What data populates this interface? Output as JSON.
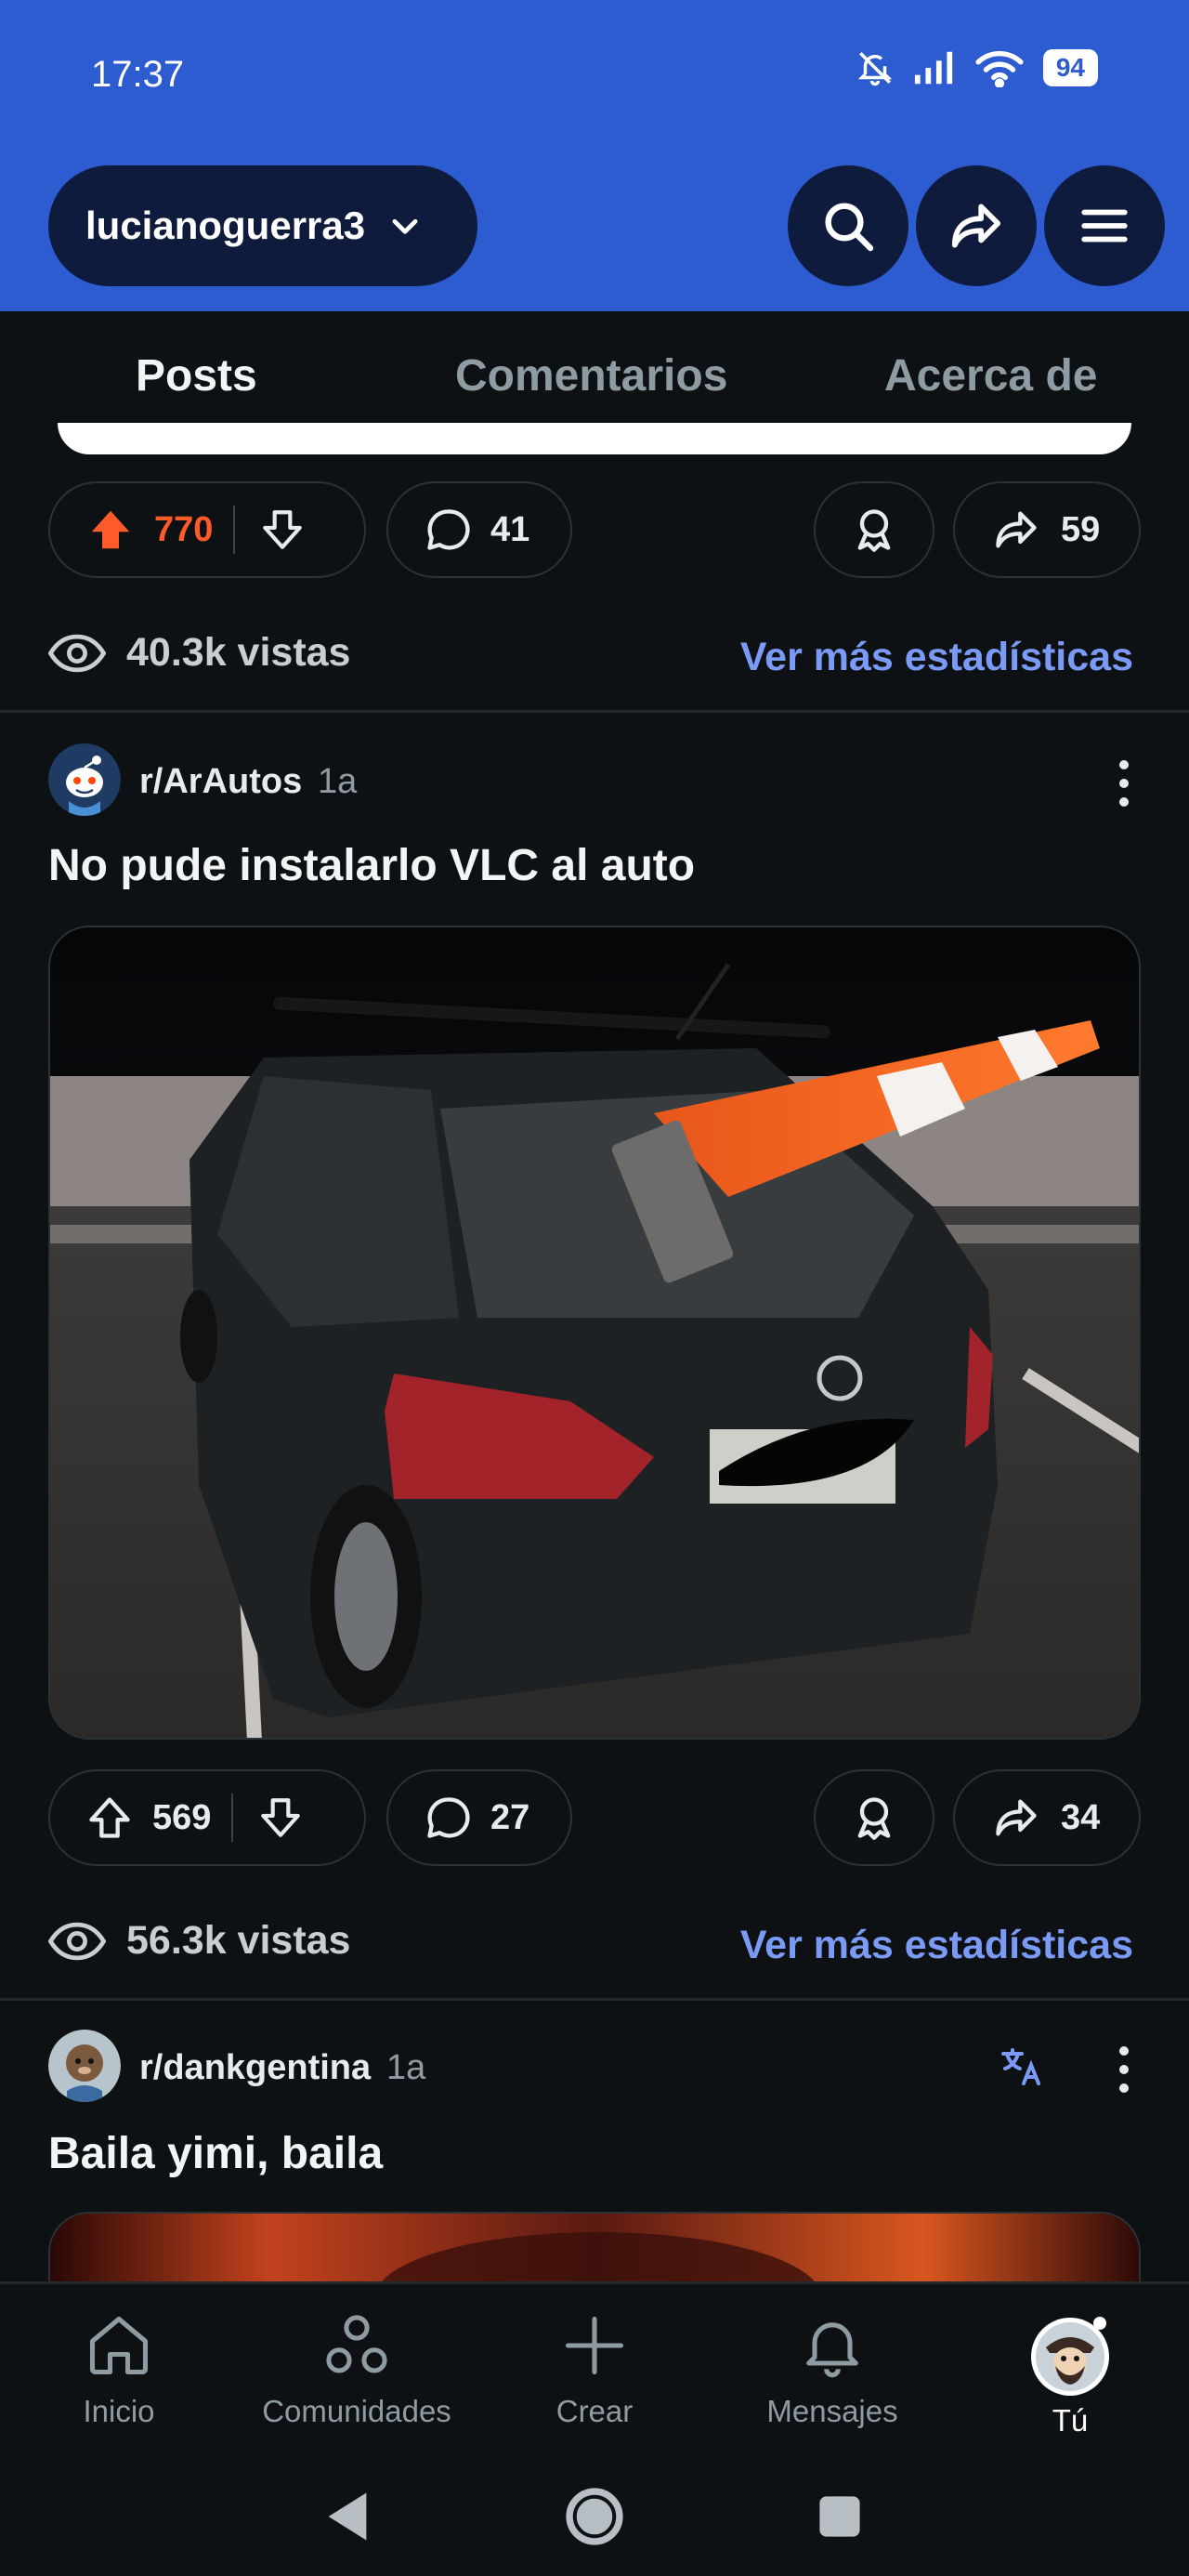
{
  "status_bar": {
    "time": "17:37",
    "battery": "94"
  },
  "header": {
    "account_name": "lucianoguerra3"
  },
  "tabs": [
    {
      "label": "Posts"
    },
    {
      "label": "Comentarios"
    },
    {
      "label": "Acerca de"
    }
  ],
  "previous_post": {
    "upvotes": "770",
    "comments": "41",
    "shares": "59",
    "views": "40.3k vistas",
    "stats_link": "Ver más estadísticas"
  },
  "post1": {
    "subreddit": "r/ArAutos",
    "age": "1a",
    "title": "No pude instalarlo VLC al auto",
    "upvotes": "569",
    "comments": "27",
    "shares": "34",
    "views": "56.3k vistas",
    "stats_link": "Ver más estadísticas"
  },
  "post2": {
    "subreddit": "r/dankgentina",
    "age": "1a",
    "title": "Baila yimi, baila"
  },
  "bottom_nav": [
    {
      "label": "Inicio",
      "icon": "home-icon"
    },
    {
      "label": "Comunidades",
      "icon": "communities-icon"
    },
    {
      "label": "Crear",
      "icon": "plus-icon"
    },
    {
      "label": "Mensajes",
      "icon": "bell-icon"
    },
    {
      "label": "Tú",
      "icon": "avatar"
    }
  ],
  "colors": {
    "brand_blue": "#2d5bd0",
    "upvote_orange": "#ff5a2a",
    "link_blue": "#7a9af5",
    "background": "#0e1113"
  }
}
